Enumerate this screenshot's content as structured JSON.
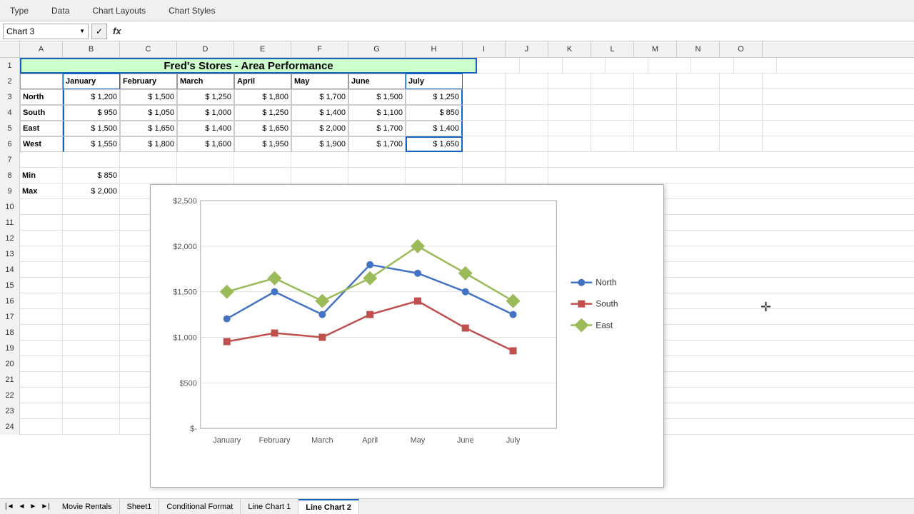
{
  "toolbar": {
    "items": [
      "Type",
      "Data",
      "Chart Layouts",
      "Chart Styles"
    ]
  },
  "formulaBar": {
    "nameBox": "Chart 3",
    "fxLabel": "fx"
  },
  "columns": [
    "A",
    "B",
    "C",
    "D",
    "E",
    "F",
    "G",
    "H",
    "I",
    "J",
    "K",
    "L",
    "M",
    "N",
    "O"
  ],
  "title": "Fred's Stores - Area Performance",
  "headers": [
    "",
    "January",
    "February",
    "March",
    "April",
    "May",
    "June",
    "July"
  ],
  "rows": [
    {
      "label": "North",
      "values": [
        "$ 1,200",
        "$ 1,500",
        "$ 1,250",
        "$ 1,800",
        "$ 1,700",
        "$ 1,500",
        "$ 1,250"
      ]
    },
    {
      "label": "South",
      "values": [
        "$    950",
        "$  1,050",
        "$  1,000",
        "$  1,250",
        "$  1,400",
        "$  1,100",
        "$    850"
      ]
    },
    {
      "label": "East",
      "values": [
        "$ 1,500",
        "$ 1,650",
        "$ 1,400",
        "$ 1,650",
        "$ 2,000",
        "$ 1,700",
        "$ 1,400"
      ]
    },
    {
      "label": "West",
      "values": [
        "$ 1,550",
        "$ 1,800",
        "$ 1,600",
        "$ 1,950",
        "$ 1,900",
        "$ 1,700",
        "$ 1,650"
      ]
    }
  ],
  "stats": [
    {
      "label": "Min",
      "value": "$     850"
    },
    {
      "label": "Max",
      "value": "$  2,000"
    }
  ],
  "chart": {
    "title": "",
    "xLabels": [
      "January",
      "February",
      "March",
      "April",
      "May",
      "June",
      "July"
    ],
    "yLabels": [
      "$-",
      "$500",
      "$1,000",
      "$1,500",
      "$2,000",
      "$2,500"
    ],
    "series": [
      {
        "name": "North",
        "color": "#4472c4",
        "values": [
          1200,
          1500,
          1250,
          1800,
          1700,
          1500,
          1250
        ]
      },
      {
        "name": "South",
        "color": "#c0504d",
        "values": [
          950,
          1050,
          1000,
          1250,
          1400,
          1100,
          850
        ]
      },
      {
        "name": "East",
        "color": "#9bbb59",
        "values": [
          1500,
          1650,
          1400,
          1650,
          2000,
          1700,
          1400
        ]
      }
    ]
  },
  "tabs": [
    "Movie Rentals",
    "Sheet1",
    "Conditional Format",
    "Line Chart 1",
    "Line Chart 2"
  ],
  "activeTab": "Line Chart 2",
  "rowNumbers": [
    1,
    2,
    3,
    4,
    5,
    6,
    7,
    8,
    9,
    10,
    11,
    12,
    13,
    14,
    15,
    16,
    17,
    18,
    19,
    20,
    21,
    22,
    23,
    24
  ]
}
